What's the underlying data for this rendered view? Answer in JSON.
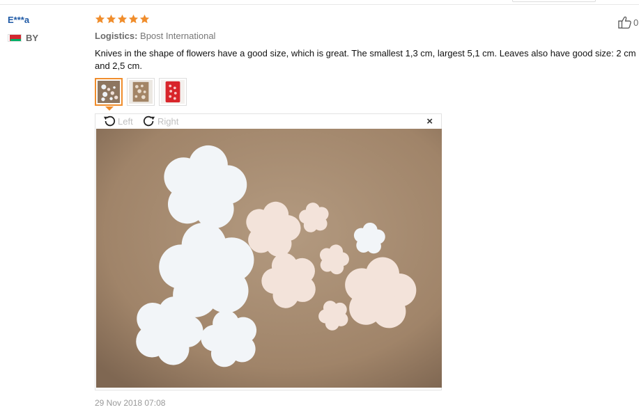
{
  "review": {
    "username": "E***a",
    "country": "BY",
    "rating": 5,
    "logistics_label": "Logistics:",
    "logistics_value": "Bpost International",
    "text": "Knives in the shape of flowers have a good size, which is great. The smallest 1,3 cm, largest 5,1 cm. Leaves also have good size: 2 cm and 2,5 cm.",
    "date": "29 Nov 2018 07:08",
    "like_count": "0"
  },
  "viewer": {
    "rotate_left_label": "Left",
    "rotate_right_label": "Right",
    "close_label": "×"
  },
  "thumbnails": [
    {
      "name": "photo-1",
      "selected": true
    },
    {
      "name": "photo-2",
      "selected": false
    },
    {
      "name": "photo-3",
      "selected": false
    }
  ],
  "colors": {
    "star": "#f08d2c",
    "username": "#1f5aa6",
    "selected_border": "#f08d2c",
    "cardboard": "#a48b72"
  }
}
